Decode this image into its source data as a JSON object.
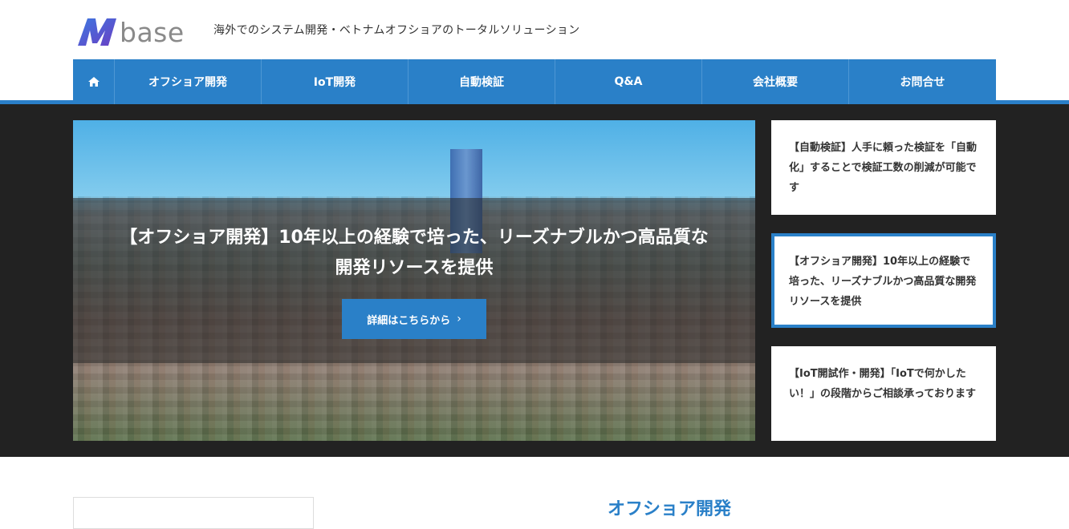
{
  "header": {
    "logo_text": "Mbase",
    "logo_word": "base",
    "tagline": "海外でのシステム開発・ベトナムオフショアのトータルソリューション"
  },
  "nav": {
    "home_icon": "home-icon",
    "items": [
      {
        "label": "オフショア開発"
      },
      {
        "label": "IoT開発"
      },
      {
        "label": "自動検証"
      },
      {
        "label": "Q&A"
      },
      {
        "label": "会社概要"
      },
      {
        "label": "お問合せ"
      }
    ]
  },
  "slider": {
    "title": "【オフショア開発】10年以上の経験で培った、リーズナブルかつ高品質な開発リソースを提供",
    "button_label": "詳細はこちらから",
    "button_icon": "chevron-right-icon"
  },
  "side_cards": [
    {
      "text": "【自動検証】人手に頼った検証を「自動化」することで検証工数の削減が可能です",
      "active": false
    },
    {
      "text": "【オフショア開発】10年以上の経験で培った、リーズナブルかつ高品質な開発リソースを提供",
      "active": true
    },
    {
      "text": "【IoT開試作・開発】「IoTで何かしたい！」の段階からご相談承っております",
      "active": false
    }
  ],
  "main": {
    "section_title": "オフショア開発"
  },
  "colors": {
    "accent": "#2a80c8",
    "hero_band": "#222222",
    "logo_mark": "#4a4fd0"
  }
}
